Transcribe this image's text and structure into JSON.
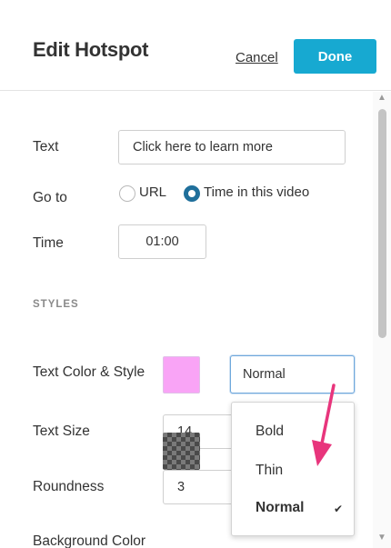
{
  "header": {
    "title": "Edit Hotspot",
    "cancel_label": "Cancel",
    "done_label": "Done"
  },
  "form": {
    "text_label": "Text",
    "text_value": "Click here to learn more",
    "goto_label": "Go to",
    "goto_options": [
      {
        "label": "URL",
        "selected": false
      },
      {
        "label": "Time in this video",
        "selected": true
      }
    ],
    "time_label": "Time",
    "time_value": "01:00",
    "section_title": "STYLES",
    "text_color_style_label": "Text Color & Style",
    "text_color": "#f9a4f6",
    "style_select_value": "Normal",
    "text_size_label": "Text Size",
    "text_size_value": "14",
    "roundness_label": "Roundness",
    "roundness_value": "3",
    "background_color_label": "Background Color"
  },
  "style_dropdown": {
    "options": [
      "Bold",
      "Thin",
      "Normal"
    ],
    "selected": "Normal",
    "check_glyph": "✔"
  },
  "icons": {
    "scroll_up": "▲",
    "scroll_down": "▼",
    "annotation_arrow": "pink-arrow-icon"
  },
  "colors": {
    "accent": "#17a9d1",
    "radio_selected": "#1f6f9b",
    "annotation_arrow": "#e8357c"
  }
}
